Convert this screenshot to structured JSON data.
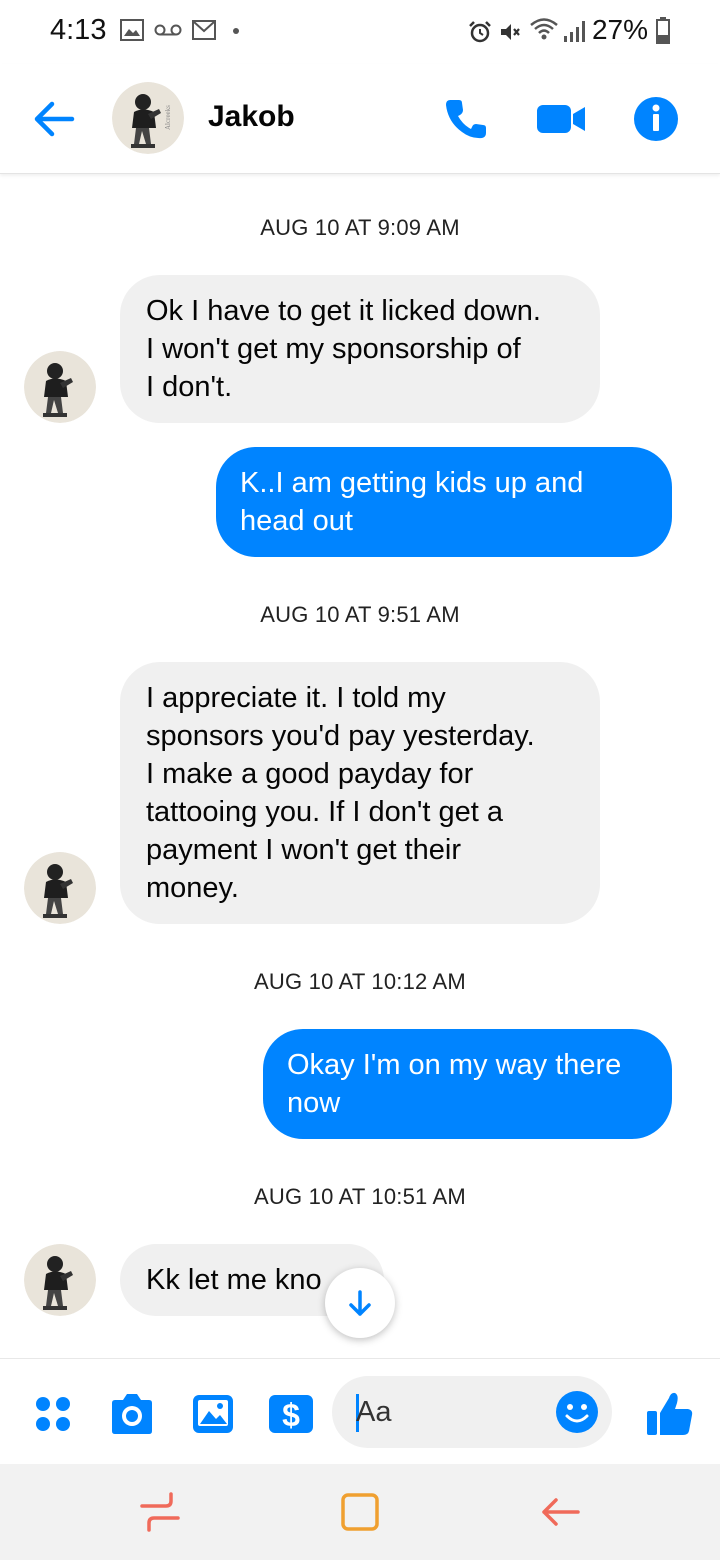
{
  "status_bar": {
    "time": "4:13",
    "battery": "27%",
    "icons": [
      "image-notification-icon",
      "voicemail-icon",
      "gmail-icon",
      "dot-icon",
      "alarm-icon",
      "mute-icon",
      "wifi-icon",
      "signal-icon",
      "battery-icon"
    ]
  },
  "header": {
    "contact_name": "Jakob",
    "icons": [
      "back-arrow-icon",
      "phone-icon",
      "video-camera-icon",
      "info-icon"
    ]
  },
  "conversation": {
    "timestamps": [
      "AUG 10 AT 9:09 AM",
      "AUG 10 AT 9:51 AM",
      "AUG 10 AT 10:12 AM",
      "AUG 10 AT 10:51 AM"
    ],
    "messages": [
      {
        "from": "contact",
        "lines": [
          "Ok I have to get it licked down.",
          "I won't get my sponsorship of",
          "I don't."
        ]
      },
      {
        "from": "me",
        "lines": [
          "K..I am getting kids up and",
          "head out"
        ]
      },
      {
        "from": "contact",
        "lines": [
          "I appreciate it. I told my",
          "sponsors you'd pay yesterday.",
          "I make a good payday for",
          "tattooing you. If I don't get a",
          "payment I won't get their",
          "money."
        ]
      },
      {
        "from": "me",
        "lines": [
          "Okay I'm on my way there",
          "now"
        ]
      },
      {
        "from": "contact",
        "lines": [
          "Kk let me kno"
        ]
      }
    ]
  },
  "composer": {
    "placeholder": "Aa",
    "icons": [
      "menu-dots-icon",
      "camera-icon",
      "gallery-icon",
      "payment-icon",
      "emoji-icon",
      "thumbs-up-icon"
    ]
  },
  "colors": {
    "accent": "#0084ff",
    "incoming_bubble": "#f0f0f0",
    "outgoing_text": "#ffffff",
    "nav_recent": "#f06a5a",
    "nav_home": "#f0a030"
  }
}
